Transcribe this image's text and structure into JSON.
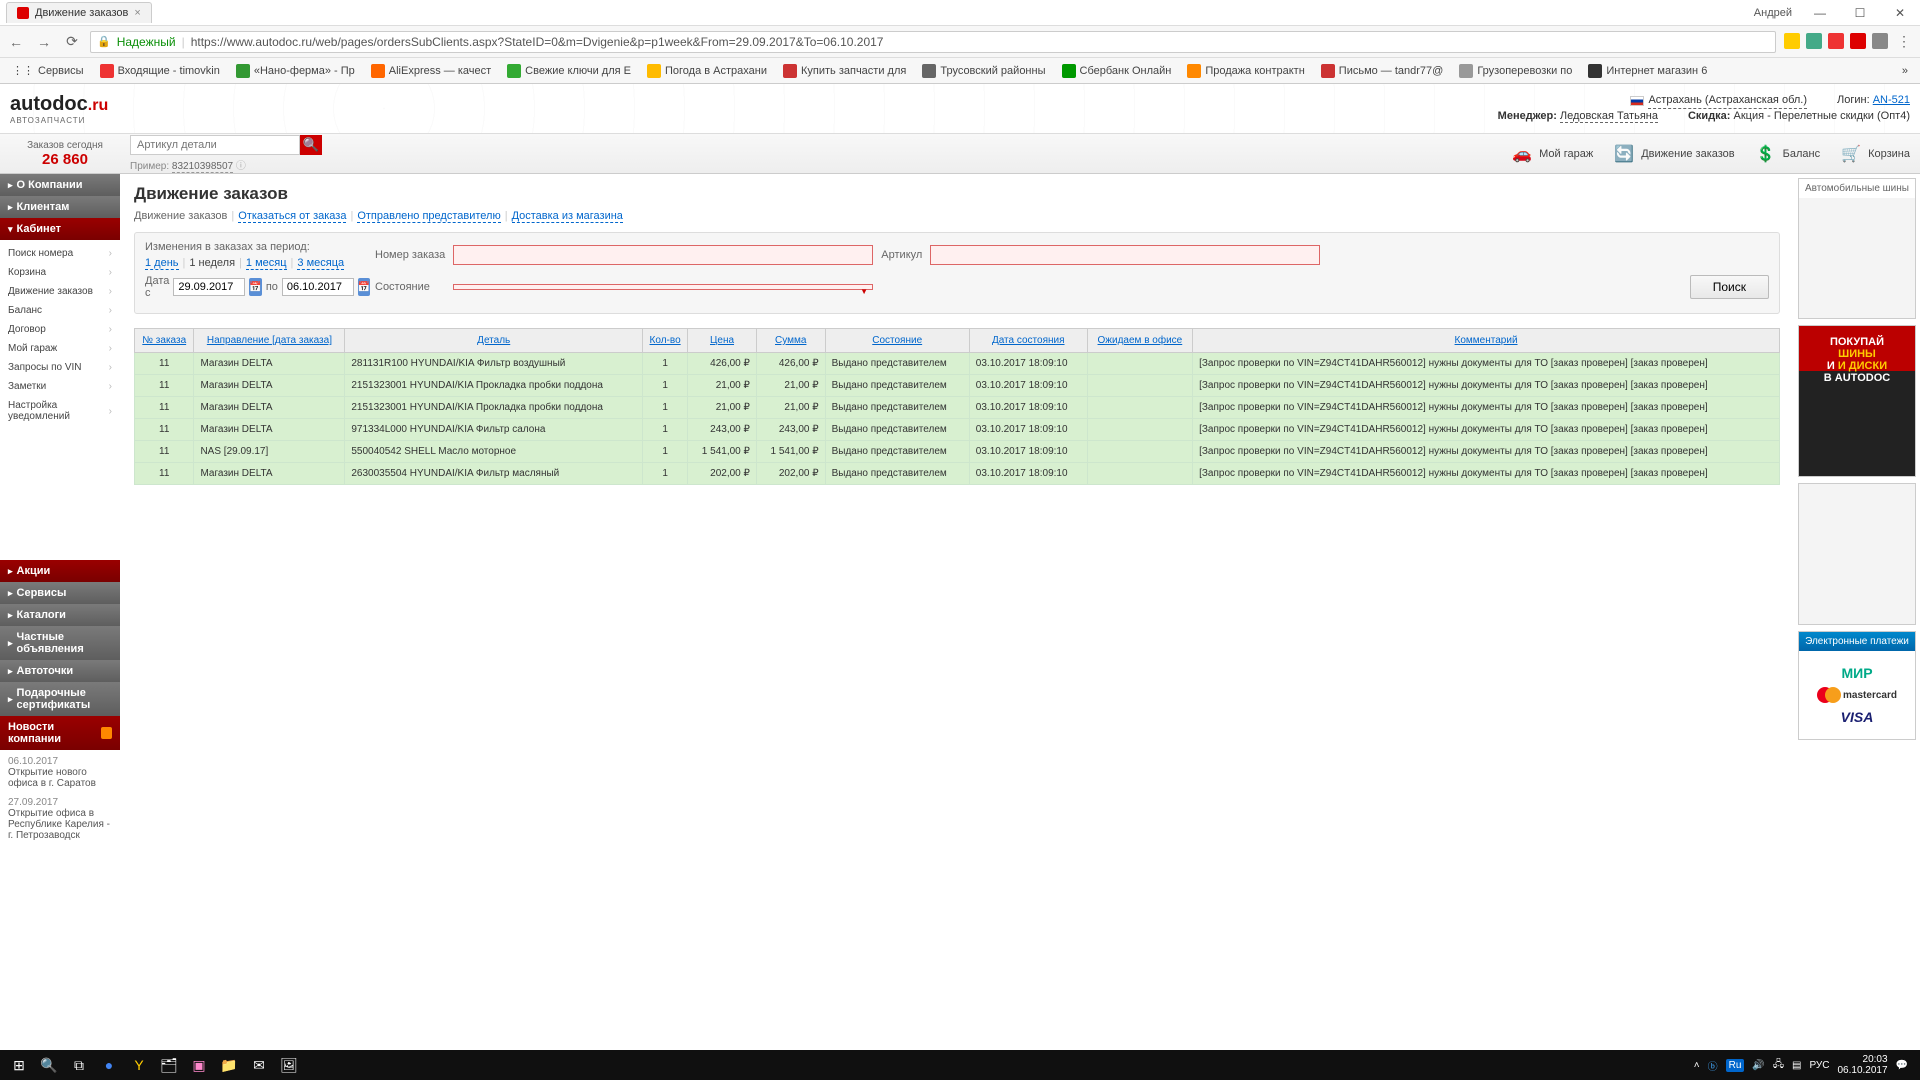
{
  "window": {
    "tab_title": "Движение заказов",
    "user": "Андрей",
    "url_safe": "Надежный",
    "url": "https://www.autodoc.ru/web/pages/ordersSubClients.aspx?StateID=0&m=Dvigenie&p=p1week&From=29.09.2017&To=06.10.2017"
  },
  "bookmarks": [
    {
      "label": "Сервисы",
      "color": "#888"
    },
    {
      "label": "Входящие - timovkin",
      "color": "#e33"
    },
    {
      "label": "«Нано-ферма» - Пр",
      "color": "#393"
    },
    {
      "label": "AliExpress — качест",
      "color": "#f60"
    },
    {
      "label": "Свежие ключи для E",
      "color": "#3a3"
    },
    {
      "label": "Погода в Астрахани",
      "color": "#fb0"
    },
    {
      "label": "Купить запчасти для",
      "color": "#c33"
    },
    {
      "label": "Трусовский районны",
      "color": "#666"
    },
    {
      "label": "Сбербанк Онлайн",
      "color": "#090"
    },
    {
      "label": "Продажа контрактн",
      "color": "#f80"
    },
    {
      "label": "Письмо — tandr77@",
      "color": "#c33"
    },
    {
      "label": "Грузоперевозки по",
      "color": "#999"
    },
    {
      "label": "Интернет магазин 6",
      "color": "#333"
    }
  ],
  "header": {
    "logo_main": "autodoc",
    "logo_suffix": ".ru",
    "logo_sub": "АВТОЗАПЧАСТИ",
    "location": "Астрахань (Астраханская обл.)",
    "manager_label": "Менеджер:",
    "manager_name": "Ледовская Татьяна",
    "login_label": "Логин:",
    "login_value": "AN-521",
    "discount_label": "Скидка:",
    "discount_value": "Акция - Перелетные скидки (Опт4)"
  },
  "site_toolbar": {
    "orders_today_label": "Заказов сегодня",
    "orders_today_count": "26 860",
    "search_placeholder": "Артикул детали",
    "search_hint_label": "Пример:",
    "search_hint_value": "83210398507",
    "links": [
      "Мой гараж",
      "Движение заказов",
      "Баланс",
      "Корзина"
    ]
  },
  "left_nav": {
    "sections": [
      {
        "label": "О Компании",
        "open": false
      },
      {
        "label": "Клиентам",
        "open": false
      },
      {
        "label": "Кабинет",
        "open": true,
        "active": true,
        "items": [
          "Поиск номера",
          "Корзина",
          "Движение заказов",
          "Баланс",
          "Договор",
          "Мой гараж",
          "Запросы по VIN",
          "Заметки",
          "Настройка уведомлений"
        ]
      },
      {
        "label": "Акции",
        "open": false,
        "active": true
      },
      {
        "label": "Сервисы",
        "open": false
      },
      {
        "label": "Каталоги",
        "open": false
      },
      {
        "label": "Частные объявления",
        "open": false
      },
      {
        "label": "Автоточки",
        "open": false
      },
      {
        "label": "Подарочные сертификаты",
        "open": false
      }
    ],
    "news_title": "Новости компании",
    "news": [
      {
        "date": "06.10.2017",
        "text": "Открытие нового офиса в г. Саратов"
      },
      {
        "date": "27.09.2017",
        "text": "Открытие офиса в Республике Карелия - г. Петрозаводск"
      }
    ]
  },
  "page": {
    "title": "Движение заказов",
    "tabs": [
      "Движение заказов",
      "Отказаться от заказа",
      "Отправлено представителю",
      "Доставка из магазина"
    ],
    "period_label": "Изменения в заказах за период:",
    "period_links": [
      "1 день",
      "1 неделя",
      "1 месяц",
      "3 месяца"
    ],
    "period_current": 1,
    "date_from_label": "Дата с",
    "date_from": "29.09.2017",
    "date_to_label": "по",
    "date_to": "06.10.2017",
    "order_num_label": "Номер заказа",
    "artikul_label": "Артикул",
    "state_label": "Состояние",
    "search_btn": "Поиск"
  },
  "table": {
    "headers": [
      "№ заказа",
      "Направление [дата заказа]",
      "Деталь",
      "Кол-во",
      "Цена",
      "Сумма",
      "Состояние",
      "Дата состояния",
      "Ожидаем в офисе",
      "Комментарий"
    ],
    "rows": [
      {
        "num": "11",
        "dir": "Магазин DELTA",
        "part": "281131R100 HYUNDAI/KIA Фильтр воздушный",
        "qty": "1",
        "price": "426,00 ₽",
        "sum": "426,00 ₽",
        "state": "Выдано представителем",
        "date": "03.10.2017 18:09:10",
        "expect": "",
        "comment": "[Запрос проверки по VIN=Z94CT41DAHR560012] нужны документы для ТО [заказ проверен] [заказ проверен]"
      },
      {
        "num": "11",
        "dir": "Магазин DELTA",
        "part": "2151323001 HYUNDAI/KIA Прокладка пробки поддона",
        "qty": "1",
        "price": "21,00 ₽",
        "sum": "21,00 ₽",
        "state": "Выдано представителем",
        "date": "03.10.2017 18:09:10",
        "expect": "",
        "comment": "[Запрос проверки по VIN=Z94CT41DAHR560012] нужны документы для ТО [заказ проверен] [заказ проверен]"
      },
      {
        "num": "11",
        "dir": "Магазин DELTA",
        "part": "2151323001 HYUNDAI/KIA Прокладка пробки поддона",
        "qty": "1",
        "price": "21,00 ₽",
        "sum": "21,00 ₽",
        "state": "Выдано представителем",
        "date": "03.10.2017 18:09:10",
        "expect": "",
        "comment": "[Запрос проверки по VIN=Z94CT41DAHR560012] нужны документы для ТО [заказ проверен] [заказ проверен]"
      },
      {
        "num": "11",
        "dir": "Магазин DELTA",
        "part": "971334L000 HYUNDAI/KIA Фильтр салона",
        "qty": "1",
        "price": "243,00 ₽",
        "sum": "243,00 ₽",
        "state": "Выдано представителем",
        "date": "03.10.2017 18:09:10",
        "expect": "",
        "comment": "[Запрос проверки по VIN=Z94CT41DAHR560012] нужны документы для ТО [заказ проверен] [заказ проверен]"
      },
      {
        "num": "11",
        "dir": "NAS [29.09.17]",
        "part": "550040542 SHELL Масло моторное",
        "qty": "1",
        "price": "1 541,00 ₽",
        "sum": "1 541,00 ₽",
        "state": "Выдано представителем",
        "date": "03.10.2017 18:09:10",
        "expect": "",
        "comment": "[Запрос проверки по VIN=Z94CT41DAHR560012] нужны документы для ТО [заказ проверен] [заказ проверен]"
      },
      {
        "num": "11",
        "dir": "Магазин DELTA",
        "part": "2630035504 HYUNDAI/KIA Фильтр масляный",
        "qty": "1",
        "price": "202,00 ₽",
        "sum": "202,00 ₽",
        "state": "Выдано представителем",
        "date": "03.10.2017 18:09:10",
        "expect": "",
        "comment": "[Запрос проверки по VIN=Z94CT41DAHR560012] нужны документы для ТО [заказ проверен] [заказ проверен]"
      }
    ]
  },
  "right": {
    "ad1_title": "Автомобильные шины",
    "ad2_line1": "ПОКУПАЙ",
    "ad2_line2": "ШИНЫ",
    "ad2_line3": "И ДИСКИ",
    "ad2_line4": "В AUTODOC",
    "pay_title": "Электронные платежи",
    "mastercard": "mastercard"
  },
  "taskbar": {
    "lang": "РУС",
    "time": "20:03",
    "date": "06.10.2017"
  }
}
